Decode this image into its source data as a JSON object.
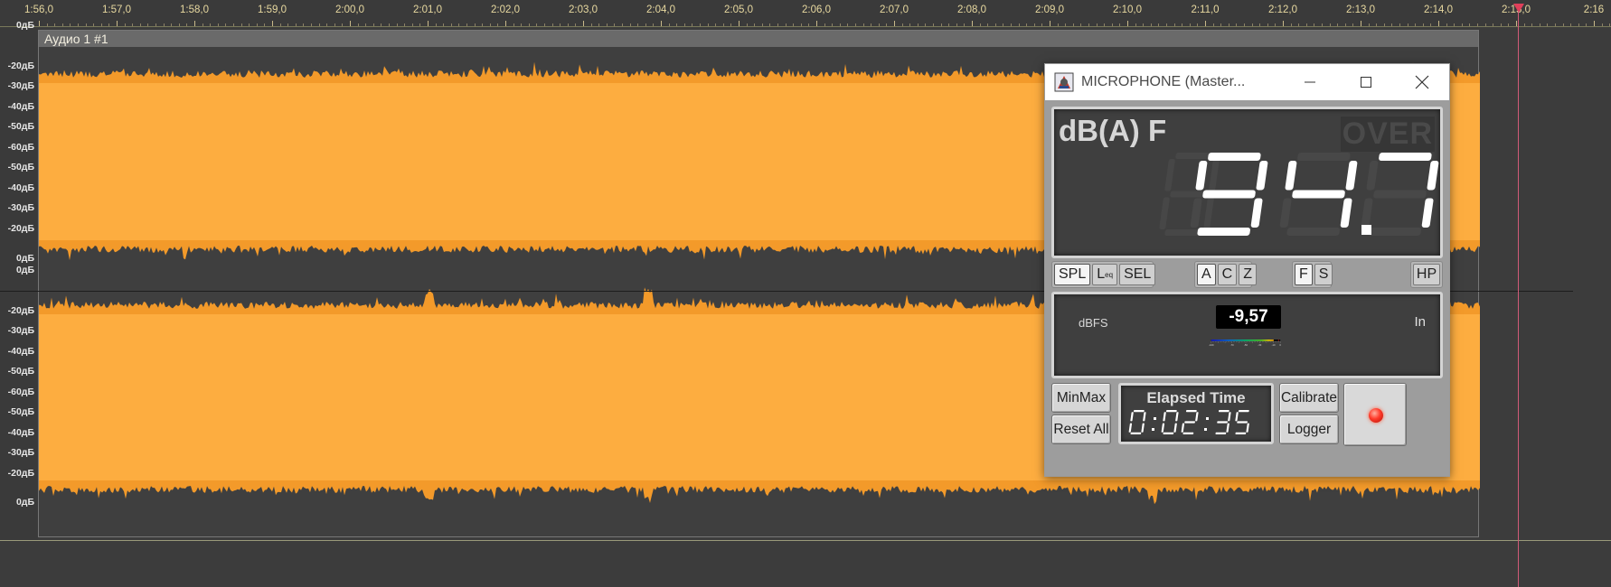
{
  "ruler": {
    "labels": [
      "1:56,0",
      "1:57,0",
      "1:58,0",
      "1:59,0",
      "2:00,0",
      "2:01,0",
      "2:02,0",
      "2:03,0",
      "2:04,0",
      "2:05,0",
      "2:06,0",
      "2:07,0",
      "2:08,0",
      "2:09,0",
      "2:10,0",
      "2:11,0",
      "2:12,0",
      "2:13,0",
      "2:14,0",
      "2:15,0",
      "2:16"
    ]
  },
  "db_scale": {
    "labels": [
      "0дБ",
      "-20дБ",
      "-30дБ",
      "-40дБ",
      "-50дБ",
      "-60дБ",
      "-50дБ",
      "-40дБ",
      "-30дБ",
      "-20дБ",
      "0дБ"
    ]
  },
  "track": {
    "title": "Аудио 1 #1",
    "waveform_color": "#fdad40",
    "waveform_edge_color": "#f39a2a"
  },
  "meter_window": {
    "title": "MICROPHONE (Master...",
    "weighting": "dB(A) F",
    "over_label": "OVER",
    "spl_value": "94.7",
    "selector": {
      "mode_buttons": [
        {
          "label": "SPL",
          "active": true
        },
        {
          "label": "L",
          "sub": "eq",
          "active": false
        },
        {
          "label": "SEL",
          "active": false
        }
      ],
      "weight_buttons": [
        {
          "label": "A",
          "active": true
        },
        {
          "label": "C",
          "active": false
        },
        {
          "label": "Z",
          "active": false
        }
      ],
      "time_buttons": [
        {
          "label": "F",
          "active": true
        },
        {
          "label": "S",
          "active": false
        }
      ],
      "hp_label": "HP"
    },
    "dbfs": {
      "unit": "dBFS",
      "value": "-9,57",
      "level": -9.57,
      "input_label": "In",
      "scale_labels": [
        "-100",
        "-70",
        "-50",
        "-30",
        "-10",
        "0"
      ],
      "scale_values": [
        -100,
        -70,
        -50,
        -30,
        -10,
        0
      ]
    },
    "buttons": {
      "minmax": "MinMax",
      "reset_all": "Reset All",
      "calibrate": "Calibrate",
      "logger": "Logger"
    },
    "elapsed": {
      "label": "Elapsed Time",
      "value": "0:02:35"
    },
    "icons": {
      "minimize": "minimize-icon",
      "maximize": "maximize-icon",
      "close": "close-icon",
      "record": "record-led-icon"
    }
  }
}
